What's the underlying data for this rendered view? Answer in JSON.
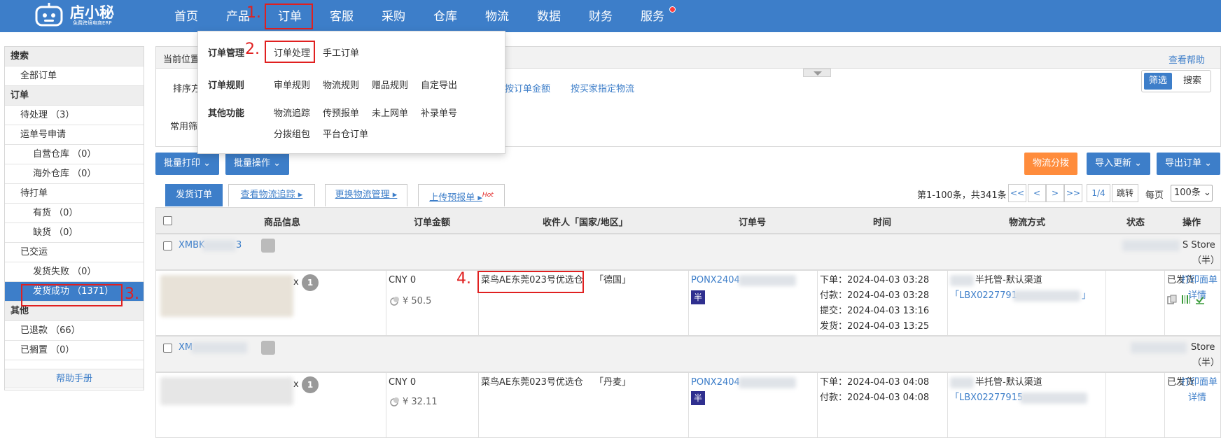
{
  "logo": {
    "name": "店小秘",
    "tagline": "免费跨境电商ERP"
  },
  "nav": [
    "首页",
    "产品",
    "订单",
    "客服",
    "采购",
    "仓库",
    "物流",
    "数据",
    "财务",
    "服务"
  ],
  "steps": [
    "1.",
    "2.",
    "3.",
    "4."
  ],
  "sidebar": {
    "search_head": "搜索",
    "all_orders": "全部订单",
    "order_head": "订单",
    "pending": "待处理 （3）",
    "waybill_apply": "运单号申请",
    "own_warehouse": "自营仓库 （0）",
    "overseas_warehouse": "海外仓库 （0）",
    "to_print": "待打单",
    "in_stock": "有货 （0）",
    "out_of_stock": "缺货 （0）",
    "shipped": "已交运",
    "ship_failed": "发货失败 （0）",
    "ship_success": "发货成功 （1371）",
    "other_head": "其他",
    "refunded": "已退款 （66）",
    "on_hold": "已搁置 （0）",
    "help": "帮助手册"
  },
  "breadcrumb": {
    "label": "当前位置",
    "help": "查看帮助"
  },
  "filter": {
    "sort_label": "排序方",
    "common_label": "常用筛",
    "sort_links": [
      "按订单金额",
      "按买家指定物流"
    ],
    "seg_filter": "筛选",
    "seg_search": "搜索"
  },
  "dropdown": {
    "groups": [
      {
        "title": "订单管理",
        "links": [
          "订单处理",
          "手工订单"
        ]
      },
      {
        "title": "订单规则",
        "links": [
          "审单规则",
          "物流规则",
          "赠品规则",
          "自定导出"
        ]
      },
      {
        "title": "其他功能",
        "links": [
          "物流追踪",
          "传预报单",
          "未上网单",
          "补录单号",
          "分拨组包",
          "平台仓订单"
        ]
      }
    ]
  },
  "actions": {
    "batch_print": "批量打印 ⌄",
    "batch_ops": "批量操作 ⌄",
    "logistics_split": "物流分拨",
    "import_update": "导入更新 ⌄",
    "export_orders": "导出订单 ⌄"
  },
  "tabs": {
    "ship_orders": "发货订单",
    "track": "查看物流追踪 ▸",
    "change_logistics": "更换物流管理 ▸",
    "upload_forecast": "上传预报单 ▸",
    "hot": "Hot"
  },
  "pagination": {
    "summary": "第1-100条，共341条",
    "first": "<<",
    "prev": "<",
    "next": ">",
    "last": ">>",
    "page": "1/4",
    "jump": "跳转",
    "per_page_label": "每页",
    "per_page": "100条 ⌄"
  },
  "table": {
    "headers": [
      "商品信息",
      "订单金额",
      "收件人「国家/地区」",
      "订单号",
      "时间",
      "物流方式",
      "状态",
      "操作"
    ],
    "groups": [
      {
        "store_code": "XMBK",
        "store_code_tail": "3",
        "store_name_tail": "S Store",
        "store_name_sub": "（半）",
        "qty": "1",
        "x": "x",
        "currency": "CNY 0",
        "amount": "¥ 50.5",
        "recipient": "菜鸟AE东莞023号优选仓",
        "country": "「德国」",
        "order_no": "PONX2404",
        "ban": "半",
        "t_order": "下单：2024-04-03 03:28",
        "t_pay": "付款：2024-04-03 03:28",
        "t_submit": "提交：2024-04-03 13:16",
        "t_ship": "发货：2024-04-03 13:25",
        "logistics": "半托管-默认渠道",
        "tracking": "「LBX0227791",
        "tracking_end": "」",
        "status": "已发货",
        "op_print": "打印面单",
        "op_detail": "详情"
      },
      {
        "store_code": "XM",
        "store_code_tail": "",
        "store_name_tail": "Store",
        "store_name_sub": "（半）",
        "qty": "1",
        "x": "x",
        "currency": "CNY 0",
        "amount": "¥ 32.11",
        "recipient": "菜鸟AE东莞023号优选仓",
        "country": "「丹麦」",
        "order_no": "PONX2404",
        "ban": "半",
        "t_order": "下单：2024-04-03 04:08",
        "t_pay": "付款：2024-04-03 04:08",
        "t_submit": "",
        "t_ship": "",
        "logistics": "半托管-默认渠道",
        "tracking": "「LBX02277915",
        "tracking_end": "",
        "status": "已发货",
        "op_print": "打印面单",
        "op_detail": "详情"
      }
    ]
  },
  "colors": {
    "brand": "#3d7ec9",
    "orange": "#ff8c3c",
    "highlight": "#e02020"
  }
}
